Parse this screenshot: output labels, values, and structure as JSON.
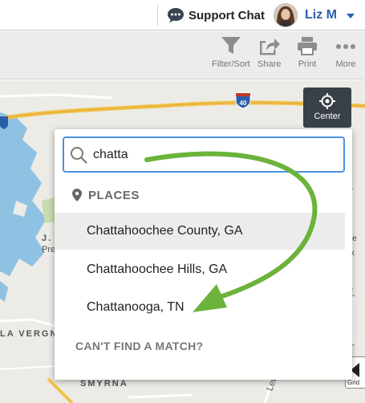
{
  "header": {
    "support_label": "Support Chat",
    "support_icon": "chat-bubble-icon",
    "user_name": "Liz M"
  },
  "toolbar": {
    "filter_label": "Filter/Sort",
    "share_label": "Share",
    "print_label": "Print",
    "more_label": "More"
  },
  "map": {
    "center_label": "Center",
    "grid_label": "Grid",
    "highway_shield": "40",
    "road_labels": {
      "la_vergne": "LA VERGNE",
      "smyrna": "SMYRNA",
      "j_percy": "J. P",
      "priest": "Prest",
      "leb": "Leb"
    },
    "side_text": {
      "ebe": "ebe",
      "ark": "ark",
      "bi": "Bl",
      "b": "B"
    },
    "colors": {
      "land": "#ecebe6",
      "water": "#8fc1e3",
      "park": "#c6dcae",
      "highway": "#f2c24a"
    }
  },
  "search": {
    "query": "chatta",
    "section_label": "PLACES",
    "results": [
      "Chattahoochee County, GA",
      "Chattahoochee Hills, GA",
      "Chattanooga, TN"
    ],
    "no_match_label": "CAN'T FIND A MATCH?",
    "focus_color": "#4a90e2"
  },
  "annotation": {
    "arrow_color": "#6bb33a",
    "points_to": "Chattanooga, TN"
  }
}
